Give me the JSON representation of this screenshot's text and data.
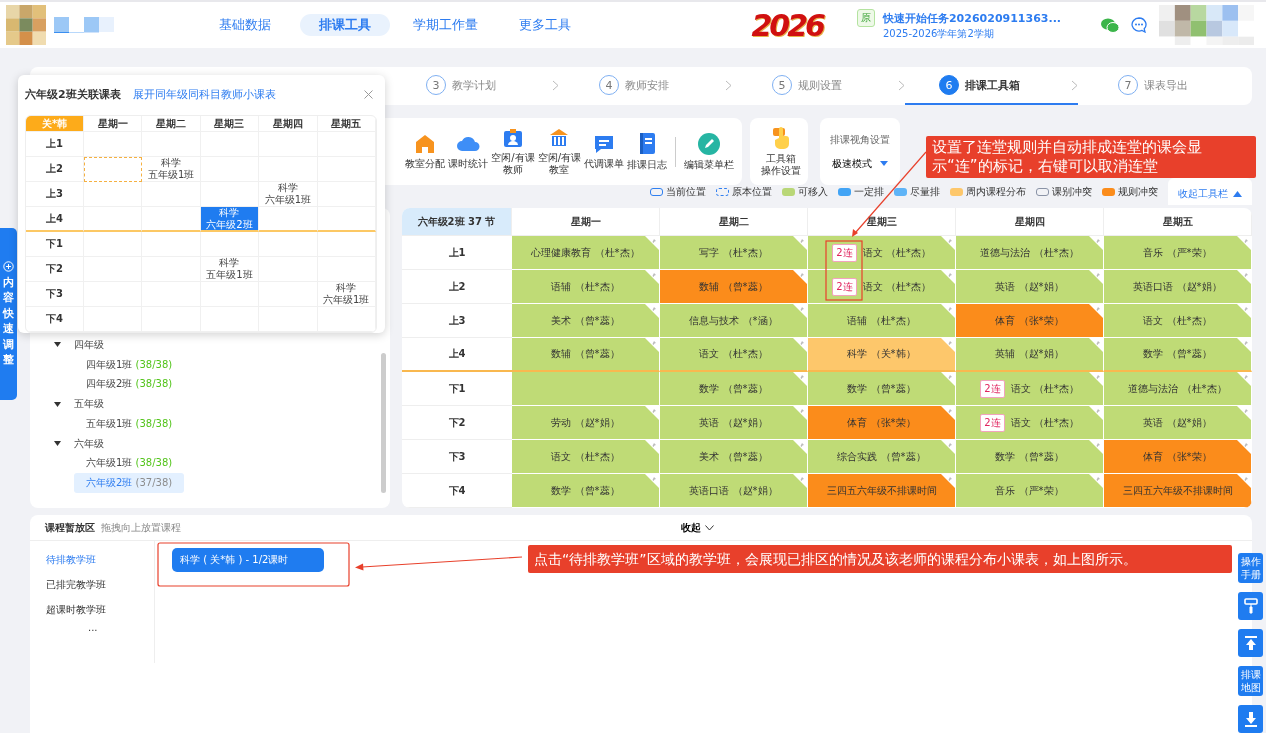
{
  "header": {
    "nav": [
      {
        "label": "基础数据",
        "selected": false
      },
      {
        "label": "排课工具",
        "selected": true
      },
      {
        "label": "学期工作量",
        "selected": false
      },
      {
        "label": "更多工具",
        "selected": false
      }
    ],
    "event_logo": "2026",
    "task": {
      "badge": "原",
      "title": "快速开始任务2026020911363...",
      "term": "2025-2026学年第2学期"
    }
  },
  "side_tab": {
    "label": "内容快速调整"
  },
  "steps": [
    {
      "number": "3",
      "label": "教学计划",
      "selected": false
    },
    {
      "number": "4",
      "label": "教师安排",
      "selected": false
    },
    {
      "number": "5",
      "label": "规则设置",
      "selected": false
    },
    {
      "number": "6",
      "label": "排课工具箱",
      "selected": true
    },
    {
      "number": "7",
      "label": "课表导出",
      "selected": false
    }
  ],
  "toolbar": {
    "items": [
      [
        "教室分配"
      ],
      [
        "课时统计"
      ],
      [
        "空闲/有课",
        "教师"
      ],
      [
        "空闲/有课",
        "教室"
      ],
      [
        "代调课单"
      ],
      [
        "排课日志"
      ]
    ],
    "edit_menu": "编辑菜单栏",
    "settings": [
      "工具箱",
      "操作设置"
    ],
    "view": {
      "title": "排课视角设置",
      "mode": "极速模式"
    }
  },
  "legend": [
    {
      "label": "当前位置",
      "kind": "outline",
      "color": "#2f7ff0"
    },
    {
      "label": "原本位置",
      "kind": "dashed",
      "color": "#2f7ff0"
    },
    {
      "label": "可移入",
      "kind": "fill",
      "color": "#b9d777"
    },
    {
      "label": "一定排",
      "kind": "fill",
      "color": "#42a4f5"
    },
    {
      "label": "尽量排",
      "kind": "fill",
      "color": "#5fb4f7"
    },
    {
      "label": "周内课程分布",
      "kind": "fill",
      "color": "#fdc76b"
    },
    {
      "label": "课别冲突",
      "kind": "outline",
      "color": "#8a93a6"
    },
    {
      "label": "规则冲突",
      "kind": "fill",
      "color": "#fb8c1b"
    }
  ],
  "collapse_toolbar": "收起工具栏",
  "class_tree": [
    {
      "label": "四年级",
      "expanded": true,
      "selected": false,
      "children": [
        {
          "label": "四年级1班",
          "count": "(38/38)",
          "selected": false
        },
        {
          "label": "四年级2班",
          "count": "(38/38)",
          "selected": false
        }
      ]
    },
    {
      "label": "五年级",
      "expanded": true,
      "selected": false,
      "children": [
        {
          "label": "五年级1班",
          "count": "(38/38)",
          "selected": false
        }
      ]
    },
    {
      "label": "六年级",
      "expanded": true,
      "selected": false,
      "children": [
        {
          "label": "六年级1班",
          "count": "(38/38)",
          "selected": false
        },
        {
          "label": "六年级2班",
          "count": "(37/38)",
          "selected": true
        }
      ]
    }
  ],
  "timetable": {
    "corner": "六年级2班 37 节",
    "days": [
      "星期一",
      "星期二",
      "星期三",
      "星期四",
      "星期五"
    ],
    "rows": [
      {
        "period": "上1",
        "session_break": false,
        "cells": [
          {
            "text": "心理健康教育 （杜*杰）",
            "kind": "movable"
          },
          {
            "text": "写字 （杜*杰）",
            "kind": "movable"
          },
          {
            "text": "语文 （杜*杰）",
            "kind": "movable",
            "linked": "2连"
          },
          {
            "text": "道德与法治 （杜*杰）",
            "kind": "movable"
          },
          {
            "text": "音乐 （严*荣）",
            "kind": "movable"
          }
        ]
      },
      {
        "period": "上2",
        "session_break": false,
        "cells": [
          {
            "text": "语辅 （杜*杰）",
            "kind": "movable"
          },
          {
            "text": "数辅 （曾*蕊）",
            "kind": "rule-conflict"
          },
          {
            "text": "语文 （杜*杰）",
            "kind": "movable",
            "linked": "2连"
          },
          {
            "text": "英语 （赵*娟）",
            "kind": "movable"
          },
          {
            "text": "英语口语 （赵*娟）",
            "kind": "movable"
          }
        ]
      },
      {
        "period": "上3",
        "session_break": false,
        "cells": [
          {
            "text": "美术 （曾*蕊）",
            "kind": "movable"
          },
          {
            "text": "信息与技术 （*涵）",
            "kind": "movable"
          },
          {
            "text": "语辅 （杜*杰）",
            "kind": "movable"
          },
          {
            "text": "体育 （张*荣）",
            "kind": "rule-conflict"
          },
          {
            "text": "语文 （杜*杰）",
            "kind": "movable"
          }
        ]
      },
      {
        "period": "上4",
        "session_break": true,
        "cells": [
          {
            "text": "数辅 （曾*蕊）",
            "kind": "movable"
          },
          {
            "text": "语文 （杜*杰）",
            "kind": "movable"
          },
          {
            "text": "科学 （关*韩）",
            "kind": "weekly-distribution"
          },
          {
            "text": "英辅 （赵*娟）",
            "kind": "movable"
          },
          {
            "text": "数学 （曾*蕊）",
            "kind": "movable"
          }
        ]
      },
      {
        "period": "下1",
        "session_break": false,
        "cells": [
          {
            "kind": "movable"
          },
          {
            "text": "数学 （曾*蕊）",
            "kind": "movable"
          },
          {
            "text": "数学 （曾*蕊）",
            "kind": "movable"
          },
          {
            "text": "语文 （杜*杰）",
            "kind": "movable",
            "linked": "2连"
          },
          {
            "text": "道德与法治 （杜*杰）",
            "kind": "movable"
          }
        ]
      },
      {
        "period": "下2",
        "session_break": false,
        "cells": [
          {
            "text": "劳动 （赵*娟）",
            "kind": "movable"
          },
          {
            "text": "英语 （赵*娟）",
            "kind": "movable"
          },
          {
            "text": "体育 （张*荣）",
            "kind": "rule-conflict"
          },
          {
            "text": "语文 （杜*杰）",
            "kind": "movable",
            "linked": "2连"
          },
          {
            "text": "英语 （赵*娟）",
            "kind": "movable"
          }
        ]
      },
      {
        "period": "下3",
        "session_break": false,
        "cells": [
          {
            "text": "语文 （杜*杰）",
            "kind": "movable"
          },
          {
            "text": "美术 （曾*蕊）",
            "kind": "movable"
          },
          {
            "text": "综合实践 （曾*蕊）",
            "kind": "movable"
          },
          {
            "text": "数学 （曾*蕊）",
            "kind": "movable"
          },
          {
            "text": "体育 （张*荣）",
            "kind": "rule-conflict"
          }
        ]
      },
      {
        "period": "下4",
        "session_break": false,
        "cells": [
          {
            "text": "数学 （曾*蕊）",
            "kind": "movable"
          },
          {
            "text": "英语口语 （赵*娟）",
            "kind": "movable"
          },
          {
            "text": "三四五六年级不排课时间",
            "kind": "rule-conflict"
          },
          {
            "text": "音乐 （严*荣）",
            "kind": "movable"
          },
          {
            "text": "三四五六年级不排课时间",
            "kind": "rule-conflict"
          }
        ]
      }
    ]
  },
  "holding_area": {
    "title": "课程暂放区",
    "hint": "拖拽向上放置课程",
    "collapse": "收起",
    "tabs": [
      {
        "label": "待排教学班",
        "selected": true
      },
      {
        "label": "已排完教学班",
        "selected": false
      },
      {
        "label": "超课时教学班",
        "selected": false
      }
    ],
    "more": "...",
    "courses": [
      "科学 ( 关*韩 ) - 1/2课时"
    ]
  },
  "popup": {
    "title": "六年级2班关联课表",
    "link": "展开同年级同科目教师小课表",
    "teacher": "关*韩",
    "days": [
      "星期一",
      "星期二",
      "星期三",
      "星期四",
      "星期五"
    ],
    "rows": [
      {
        "period": "上1",
        "session_break": false,
        "cells": [
          {
            "kind": "empty"
          },
          {
            "kind": "empty"
          },
          {
            "kind": "empty"
          },
          {
            "kind": "empty"
          },
          {
            "kind": "empty"
          }
        ]
      },
      {
        "period": "上2",
        "session_break": false,
        "cells": [
          {
            "kind": "original"
          },
          {
            "kind": "lesson",
            "subject": "科学",
            "class": "五年级1班"
          },
          {
            "kind": "empty"
          },
          {
            "kind": "empty"
          },
          {
            "kind": "empty"
          }
        ]
      },
      {
        "period": "上3",
        "session_break": false,
        "cells": [
          {
            "kind": "empty"
          },
          {
            "kind": "empty"
          },
          {
            "kind": "empty"
          },
          {
            "kind": "lesson",
            "subject": "科学",
            "class": "六年级1班"
          },
          {
            "kind": "empty"
          }
        ]
      },
      {
        "period": "上4",
        "session_break": true,
        "cells": [
          {
            "kind": "empty"
          },
          {
            "kind": "empty"
          },
          {
            "kind": "current",
            "subject": "科学",
            "class": "六年级2班"
          },
          {
            "kind": "empty"
          },
          {
            "kind": "empty"
          }
        ]
      },
      {
        "period": "下1",
        "session_break": false,
        "cells": [
          {
            "kind": "empty"
          },
          {
            "kind": "empty"
          },
          {
            "kind": "empty"
          },
          {
            "kind": "empty"
          },
          {
            "kind": "empty"
          }
        ]
      },
      {
        "period": "下2",
        "session_break": false,
        "cells": [
          {
            "kind": "empty"
          },
          {
            "kind": "empty"
          },
          {
            "kind": "lesson",
            "subject": "科学",
            "class": "五年级1班"
          },
          {
            "kind": "empty"
          },
          {
            "kind": "empty"
          }
        ]
      },
      {
        "period": "下3",
        "session_break": false,
        "cells": [
          {
            "kind": "empty"
          },
          {
            "kind": "empty"
          },
          {
            "kind": "empty"
          },
          {
            "kind": "empty"
          },
          {
            "kind": "lesson",
            "subject": "科学",
            "class": "六年级1班"
          }
        ]
      },
      {
        "period": "下4",
        "session_break": false,
        "cells": [
          {
            "kind": "empty"
          },
          {
            "kind": "empty"
          },
          {
            "kind": "empty"
          },
          {
            "kind": "empty"
          },
          {
            "kind": "empty"
          }
        ]
      }
    ]
  },
  "float_buttons": [
    {
      "kind": "text",
      "label": "操作手册"
    },
    {
      "kind": "paint"
    },
    {
      "kind": "top"
    },
    {
      "kind": "text",
      "label": "排课地图"
    },
    {
      "kind": "download"
    }
  ],
  "annotations": [
    {
      "text": "设置了连堂规则并自动排成连堂的课会显示“连”的标记，右键可以取消连堂"
    },
    {
      "text": "点击“待排教学班”区域的教学班，会展现已排区的情况及该老师的课程分布小课表，如上图所示。"
    }
  ]
}
